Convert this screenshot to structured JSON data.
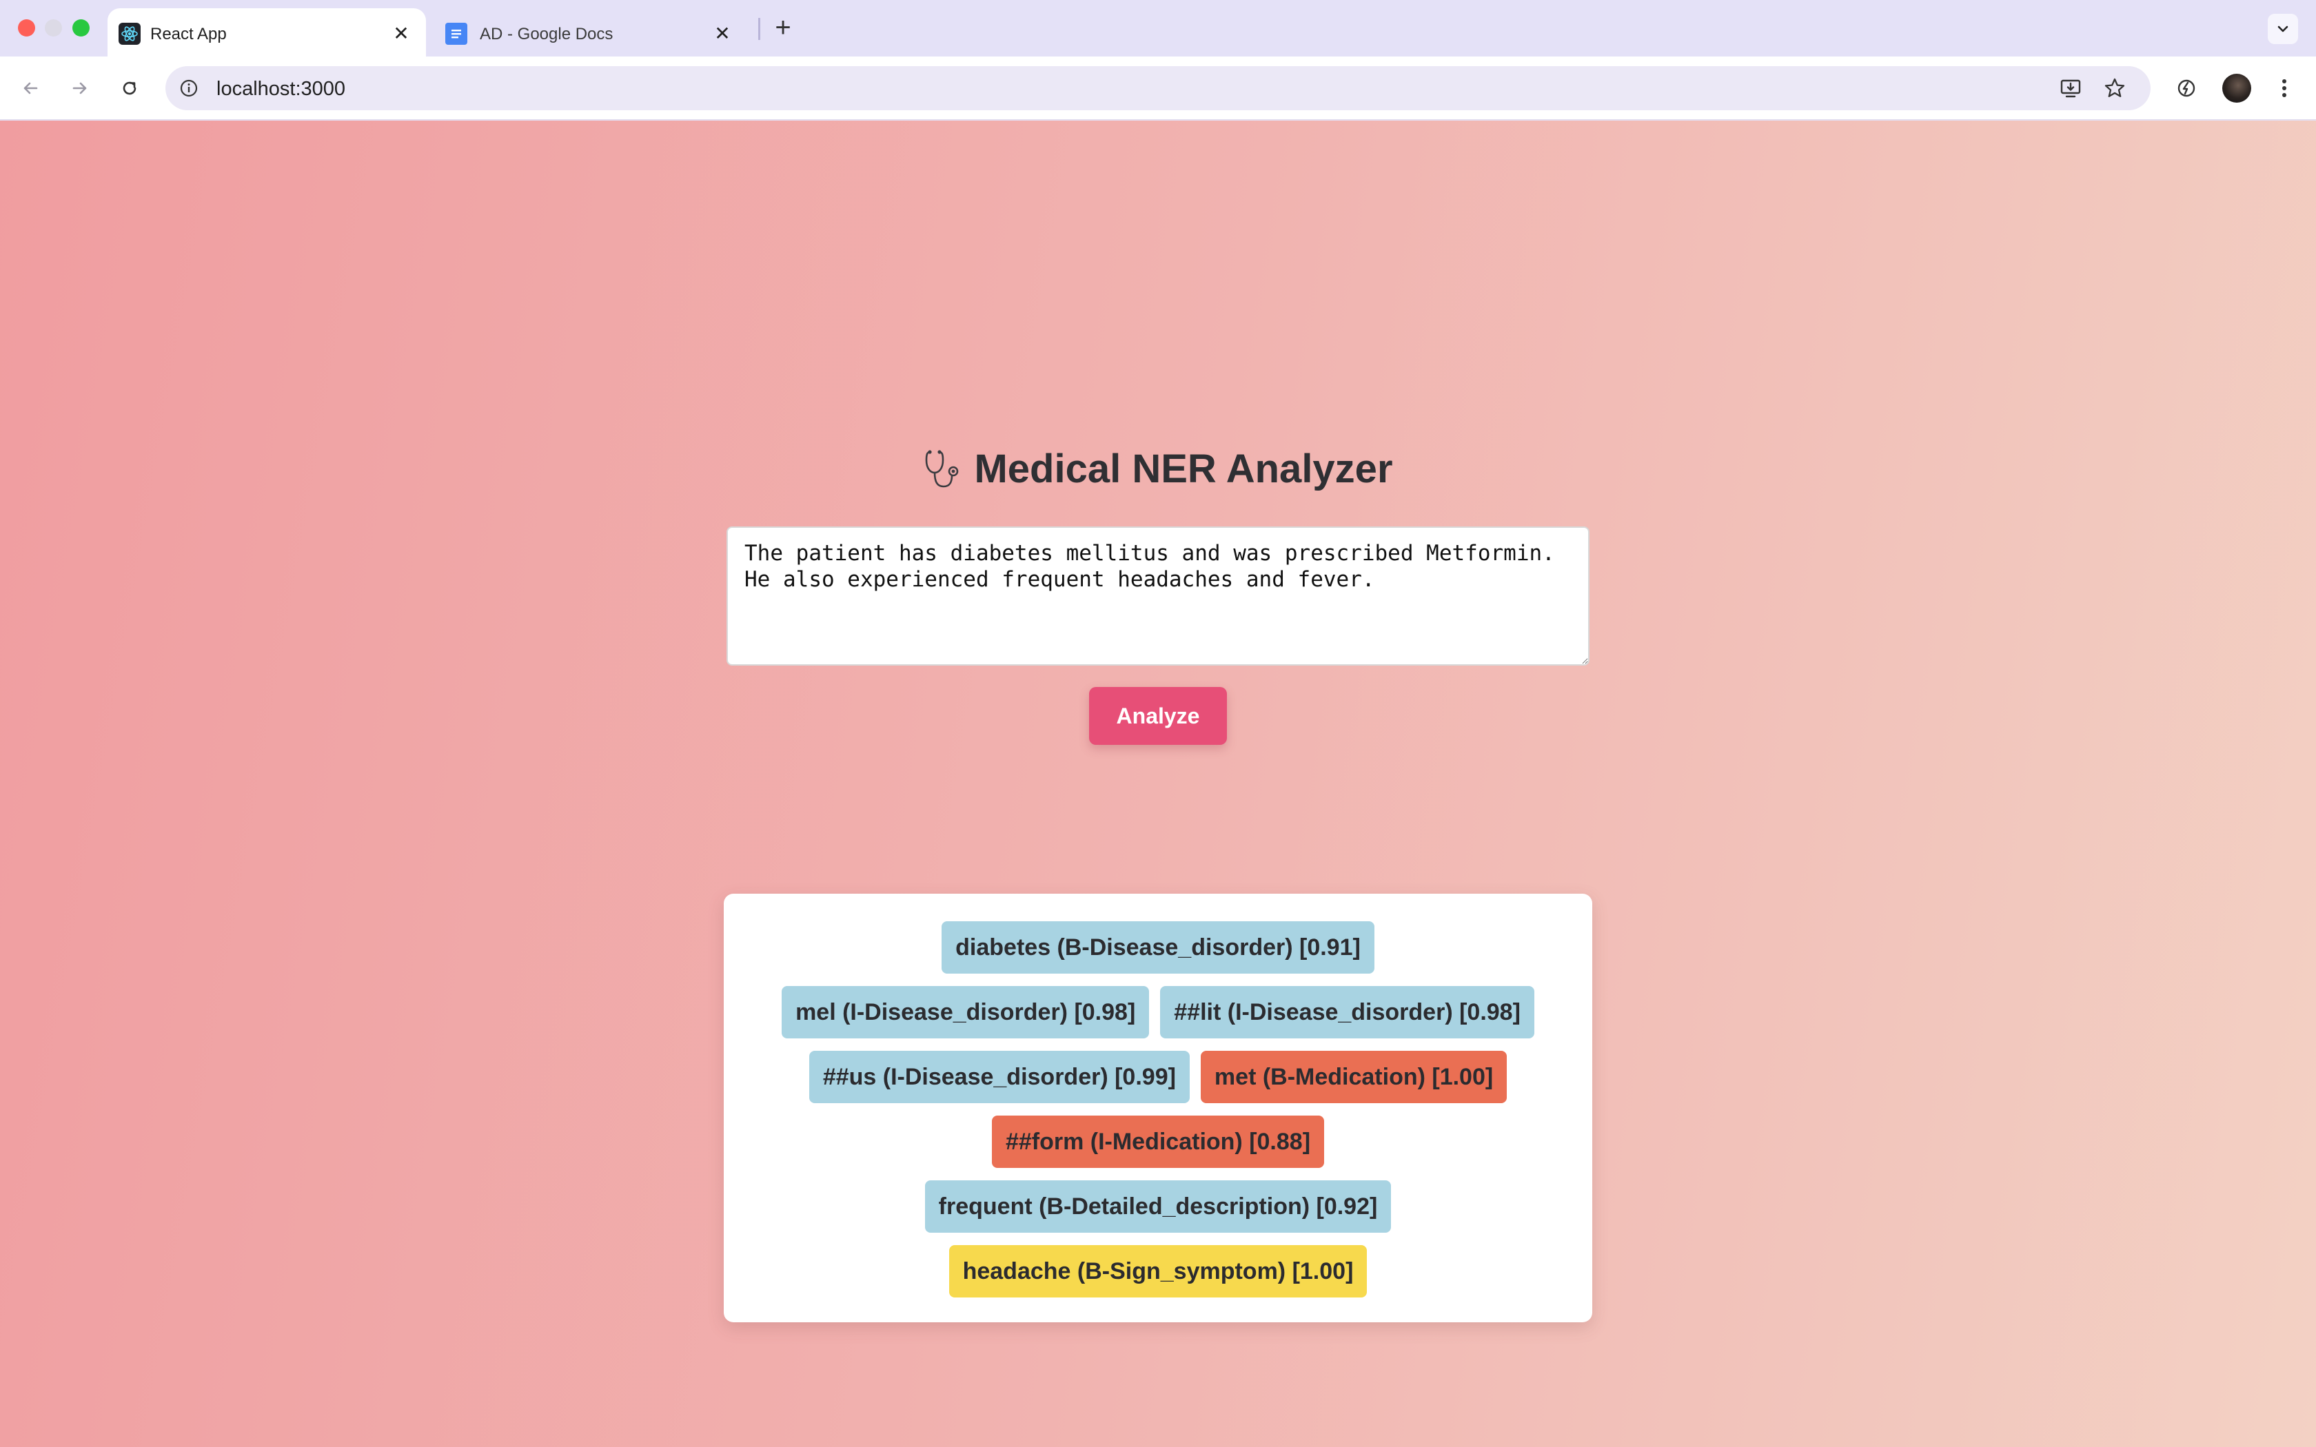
{
  "browser": {
    "tabs": [
      {
        "title": "React App",
        "favicon": "react-icon",
        "active": true
      },
      {
        "title": "AD - Google Docs",
        "favicon": "google-docs-icon",
        "active": false
      }
    ],
    "new_tab": "+",
    "close_glyph": "✕",
    "url": "localhost:3000",
    "colors": {
      "tabstrip": "#e4e1f7",
      "omnibox": "#ebe8f6"
    }
  },
  "app": {
    "title": "Medical NER Analyzer",
    "title_icon": "stethoscope-icon",
    "input_text": "The patient has diabetes mellitus and was prescribed Metformin. He also experienced frequent headaches and fever.",
    "analyze_label": "Analyze",
    "colors": {
      "background_start": "#f09da0",
      "background_end": "#f3d1c4",
      "button": "#e74f77",
      "disease": "#a8d3e2",
      "medication": "#ea6f53",
      "symptom": "#f7d94d"
    },
    "entity_rows": [
      [
        {
          "text": "diabetes (B-Disease_disorder) [0.91]",
          "category": "disease"
        }
      ],
      [
        {
          "text": "mel (I-Disease_disorder) [0.98]",
          "category": "disease"
        },
        {
          "text": "##lit (I-Disease_disorder) [0.98]",
          "category": "disease"
        }
      ],
      [
        {
          "text": "##us (I-Disease_disorder) [0.99]",
          "category": "disease"
        },
        {
          "text": "met (B-Medication) [1.00]",
          "category": "medication"
        }
      ],
      [
        {
          "text": "##form (I-Medication) [0.88]",
          "category": "medication"
        }
      ],
      [
        {
          "text": "frequent (B-Detailed_description) [0.92]",
          "category": "disease"
        }
      ],
      [
        {
          "text": "headache (B-Sign_symptom) [1.00]",
          "category": "symptom"
        }
      ]
    ]
  }
}
